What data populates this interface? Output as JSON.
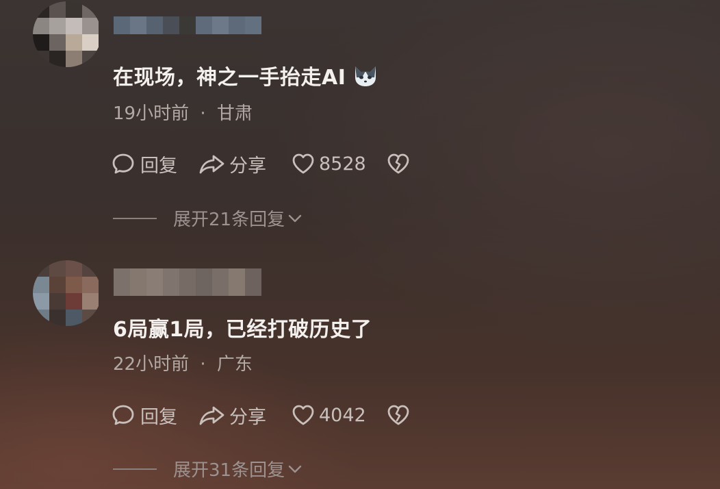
{
  "comments": [
    {
      "text": "在现场，神之一手抬走AI",
      "emoji": "cat-face-icon",
      "time": "19小时前",
      "separator": "·",
      "location": "甘肃",
      "reply_label": "回复",
      "share_label": "分享",
      "like_count": "8528",
      "expand_label": "展开21条回复"
    },
    {
      "text": "6局赢1局，已经打破历史了",
      "time": "22小时前",
      "separator": "·",
      "location": "广东",
      "reply_label": "回复",
      "share_label": "分享",
      "like_count": "4042",
      "expand_label": "展开31条回复"
    }
  ],
  "colors": {
    "text_primary": "#f4f0ee",
    "text_meta": "#b3a9a5",
    "text_action": "#c9c0bc",
    "text_expand": "#9d9290"
  }
}
